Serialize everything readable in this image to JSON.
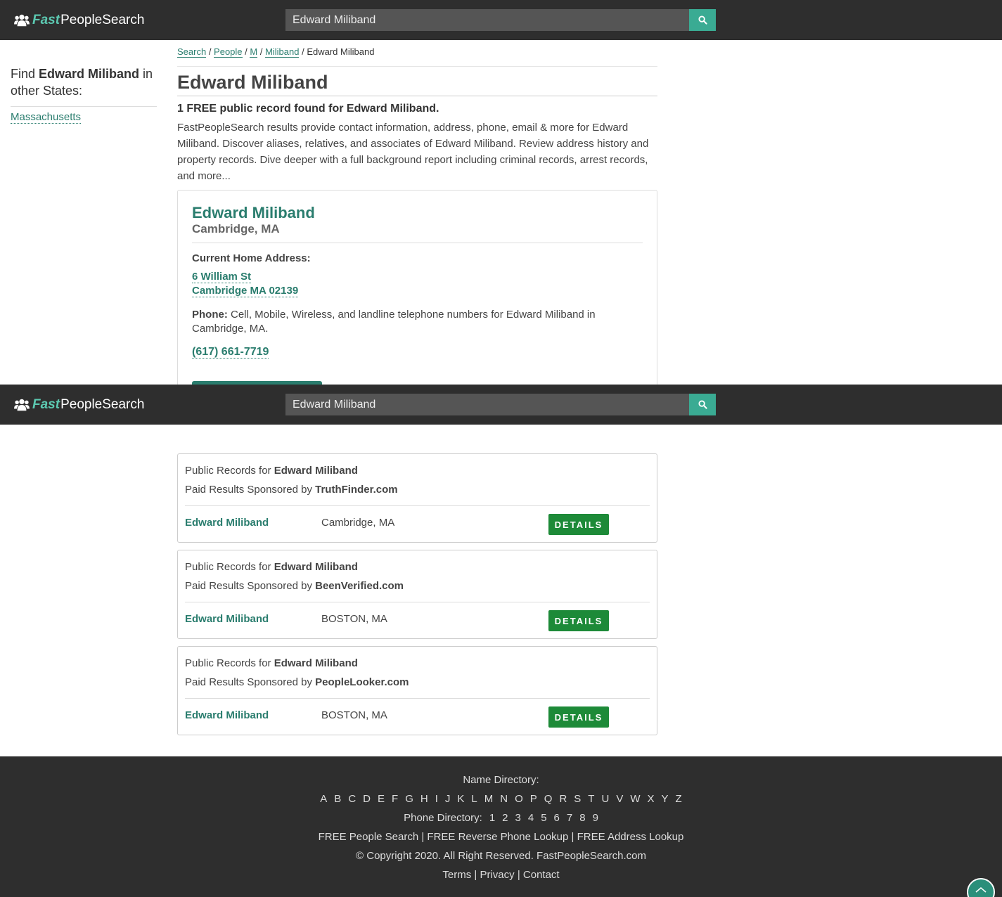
{
  "header": {
    "logo_fast": "Fast",
    "logo_rest": "PeopleSearch",
    "search_value": "Edward Miliband"
  },
  "sidebar": {
    "find_prefix": "Find ",
    "find_name": "Edward Miliband",
    "find_suffix": " in other States:",
    "states": [
      "Massachusetts"
    ]
  },
  "breadcrumb": {
    "items": [
      "Search",
      "People",
      "M",
      "Miliband"
    ],
    "current": "Edward Miliband",
    "separator": " / "
  },
  "page_title": "Edward Miliband",
  "found_text": "1 FREE public record found for Edward Miliband.",
  "description": "FastPeopleSearch results provide contact information, address, phone, email & more for Edward Miliband. Discover aliases, relatives, and associates of Edward Miliband. Review address history and property records. Dive deeper with a full background report including criminal records, arrest records, and more...",
  "card": {
    "name": "Edward Miliband",
    "location": "Cambridge, MA",
    "address_label": "Current Home Address:",
    "address_line1": "6 William St",
    "address_line2": "Cambridge MA 02139",
    "phone_label": "Phone:",
    "phone_desc": " Cell, Mobile, Wireless, and landline telephone numbers for Edward Miliband in Cambridge, MA.",
    "phone": "(617) 661-7719"
  },
  "public_records": [
    {
      "prefix": "Public Records for ",
      "name": "Edward Miliband",
      "sponsor_prefix": "Paid Results Sponsored by ",
      "sponsor": "TruthFinder.com",
      "result_name": "Edward Miliband",
      "result_location": "Cambridge, MA",
      "button": "DETAILS"
    },
    {
      "prefix": "Public Records for ",
      "name": "Edward Miliband",
      "sponsor_prefix": "Paid Results Sponsored by ",
      "sponsor": "BeenVerified.com",
      "result_name": "Edward Miliband",
      "result_location": "BOSTON, MA",
      "button": "DETAILS"
    },
    {
      "prefix": "Public Records for ",
      "name": "Edward Miliband",
      "sponsor_prefix": "Paid Results Sponsored by ",
      "sponsor": "PeopleLooker.com",
      "result_name": "Edward Miliband",
      "result_location": "BOSTON, MA",
      "button": "DETAILS"
    }
  ],
  "footer": {
    "name_directory_label": "Name Directory:",
    "letters": [
      "A",
      "B",
      "C",
      "D",
      "E",
      "F",
      "G",
      "H",
      "I",
      "J",
      "K",
      "L",
      "M",
      "N",
      "O",
      "P",
      "Q",
      "R",
      "S",
      "T",
      "U",
      "V",
      "W",
      "X",
      "Y",
      "Z"
    ],
    "phone_directory_label": "Phone Directory:",
    "digits": [
      "1",
      "2",
      "3",
      "4",
      "5",
      "6",
      "7",
      "8",
      "9"
    ],
    "free_links": [
      "FREE People Search",
      "FREE Reverse Phone Lookup",
      "FREE Address Lookup"
    ],
    "copyright": "© Copyright 2020. All Right Reserved. FastPeopleSearch.com",
    "legal_links": [
      "Terms",
      "Privacy",
      "Contact"
    ]
  }
}
